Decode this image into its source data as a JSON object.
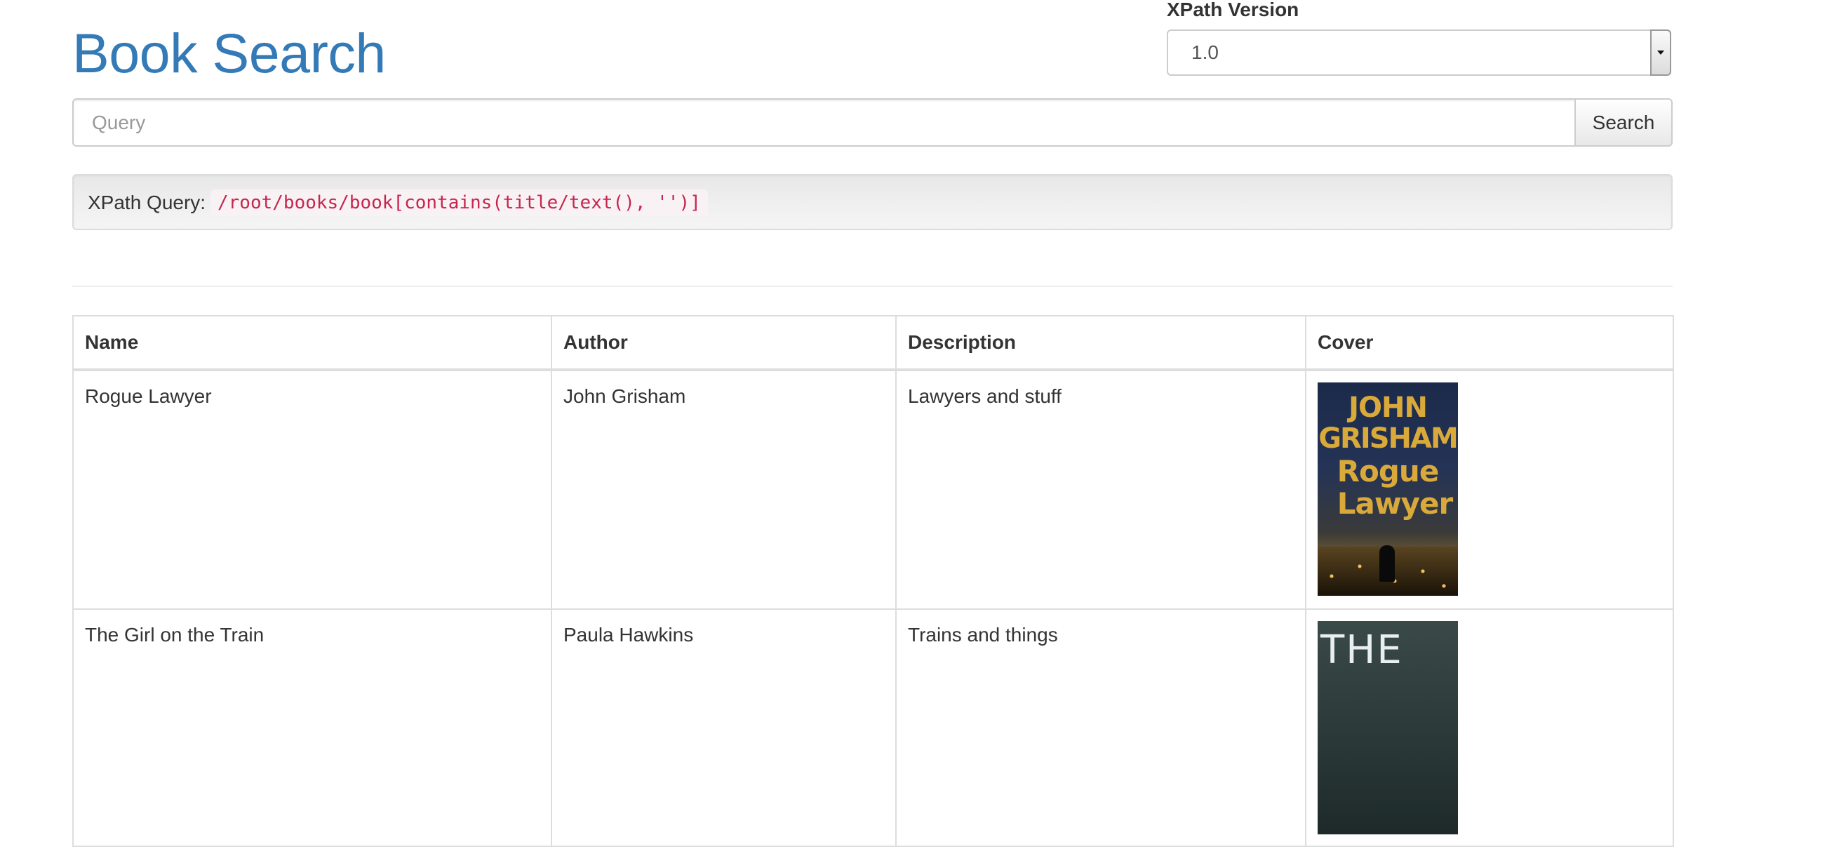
{
  "header": {
    "title": "Book Search"
  },
  "xpath_version": {
    "label": "XPath Version",
    "selected": "1.0"
  },
  "search": {
    "placeholder": "Query",
    "button_label": "Search"
  },
  "query_display": {
    "label": "XPath Query:",
    "code": "/root/books/book[contains(title/text(), '')]"
  },
  "table": {
    "columns": [
      "Name",
      "Author",
      "Description",
      "Cover"
    ],
    "rows": [
      {
        "name": "Rogue Lawyer",
        "author": "John Grisham",
        "description": "Lawyers and stuff",
        "cover": {
          "icon": "book-cover-rogue-lawyer",
          "text_lines": [
            "JOHN",
            "GRISHAM",
            "Rogue",
            "Lawyer"
          ]
        }
      },
      {
        "name": "The Girl on the Train",
        "author": "Paula Hawkins",
        "description": "Trains and things",
        "cover": {
          "icon": "book-cover-girl-on-the-train",
          "text_lines": [
            "THE"
          ]
        }
      }
    ]
  },
  "colors": {
    "title": "#337ab7",
    "code_text": "#c7254e",
    "code_bg": "#f9f2f4",
    "cover_title": "#d9a93a"
  }
}
